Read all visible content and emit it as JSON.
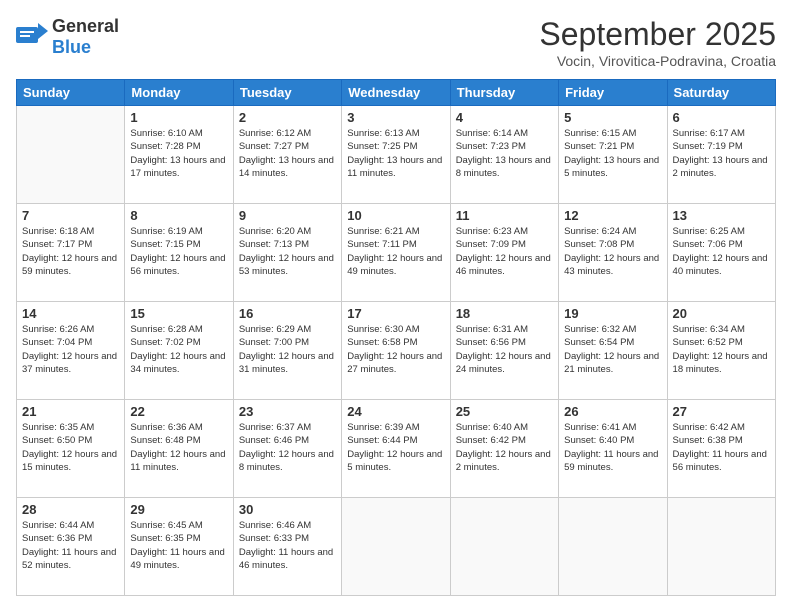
{
  "header": {
    "logo_general": "General",
    "logo_blue": "Blue",
    "title": "September 2025",
    "location": "Vocin, Virovitica-Podravina, Croatia"
  },
  "days_of_week": [
    "Sunday",
    "Monday",
    "Tuesday",
    "Wednesday",
    "Thursday",
    "Friday",
    "Saturday"
  ],
  "weeks": [
    [
      {
        "day": "",
        "sunrise": "",
        "sunset": "",
        "daylight": ""
      },
      {
        "day": "1",
        "sunrise": "Sunrise: 6:10 AM",
        "sunset": "Sunset: 7:28 PM",
        "daylight": "Daylight: 13 hours and 17 minutes."
      },
      {
        "day": "2",
        "sunrise": "Sunrise: 6:12 AM",
        "sunset": "Sunset: 7:27 PM",
        "daylight": "Daylight: 13 hours and 14 minutes."
      },
      {
        "day": "3",
        "sunrise": "Sunrise: 6:13 AM",
        "sunset": "Sunset: 7:25 PM",
        "daylight": "Daylight: 13 hours and 11 minutes."
      },
      {
        "day": "4",
        "sunrise": "Sunrise: 6:14 AM",
        "sunset": "Sunset: 7:23 PM",
        "daylight": "Daylight: 13 hours and 8 minutes."
      },
      {
        "day": "5",
        "sunrise": "Sunrise: 6:15 AM",
        "sunset": "Sunset: 7:21 PM",
        "daylight": "Daylight: 13 hours and 5 minutes."
      },
      {
        "day": "6",
        "sunrise": "Sunrise: 6:17 AM",
        "sunset": "Sunset: 7:19 PM",
        "daylight": "Daylight: 13 hours and 2 minutes."
      }
    ],
    [
      {
        "day": "7",
        "sunrise": "Sunrise: 6:18 AM",
        "sunset": "Sunset: 7:17 PM",
        "daylight": "Daylight: 12 hours and 59 minutes."
      },
      {
        "day": "8",
        "sunrise": "Sunrise: 6:19 AM",
        "sunset": "Sunset: 7:15 PM",
        "daylight": "Daylight: 12 hours and 56 minutes."
      },
      {
        "day": "9",
        "sunrise": "Sunrise: 6:20 AM",
        "sunset": "Sunset: 7:13 PM",
        "daylight": "Daylight: 12 hours and 53 minutes."
      },
      {
        "day": "10",
        "sunrise": "Sunrise: 6:21 AM",
        "sunset": "Sunset: 7:11 PM",
        "daylight": "Daylight: 12 hours and 49 minutes."
      },
      {
        "day": "11",
        "sunrise": "Sunrise: 6:23 AM",
        "sunset": "Sunset: 7:09 PM",
        "daylight": "Daylight: 12 hours and 46 minutes."
      },
      {
        "day": "12",
        "sunrise": "Sunrise: 6:24 AM",
        "sunset": "Sunset: 7:08 PM",
        "daylight": "Daylight: 12 hours and 43 minutes."
      },
      {
        "day": "13",
        "sunrise": "Sunrise: 6:25 AM",
        "sunset": "Sunset: 7:06 PM",
        "daylight": "Daylight: 12 hours and 40 minutes."
      }
    ],
    [
      {
        "day": "14",
        "sunrise": "Sunrise: 6:26 AM",
        "sunset": "Sunset: 7:04 PM",
        "daylight": "Daylight: 12 hours and 37 minutes."
      },
      {
        "day": "15",
        "sunrise": "Sunrise: 6:28 AM",
        "sunset": "Sunset: 7:02 PM",
        "daylight": "Daylight: 12 hours and 34 minutes."
      },
      {
        "day": "16",
        "sunrise": "Sunrise: 6:29 AM",
        "sunset": "Sunset: 7:00 PM",
        "daylight": "Daylight: 12 hours and 31 minutes."
      },
      {
        "day": "17",
        "sunrise": "Sunrise: 6:30 AM",
        "sunset": "Sunset: 6:58 PM",
        "daylight": "Daylight: 12 hours and 27 minutes."
      },
      {
        "day": "18",
        "sunrise": "Sunrise: 6:31 AM",
        "sunset": "Sunset: 6:56 PM",
        "daylight": "Daylight: 12 hours and 24 minutes."
      },
      {
        "day": "19",
        "sunrise": "Sunrise: 6:32 AM",
        "sunset": "Sunset: 6:54 PM",
        "daylight": "Daylight: 12 hours and 21 minutes."
      },
      {
        "day": "20",
        "sunrise": "Sunrise: 6:34 AM",
        "sunset": "Sunset: 6:52 PM",
        "daylight": "Daylight: 12 hours and 18 minutes."
      }
    ],
    [
      {
        "day": "21",
        "sunrise": "Sunrise: 6:35 AM",
        "sunset": "Sunset: 6:50 PM",
        "daylight": "Daylight: 12 hours and 15 minutes."
      },
      {
        "day": "22",
        "sunrise": "Sunrise: 6:36 AM",
        "sunset": "Sunset: 6:48 PM",
        "daylight": "Daylight: 12 hours and 11 minutes."
      },
      {
        "day": "23",
        "sunrise": "Sunrise: 6:37 AM",
        "sunset": "Sunset: 6:46 PM",
        "daylight": "Daylight: 12 hours and 8 minutes."
      },
      {
        "day": "24",
        "sunrise": "Sunrise: 6:39 AM",
        "sunset": "Sunset: 6:44 PM",
        "daylight": "Daylight: 12 hours and 5 minutes."
      },
      {
        "day": "25",
        "sunrise": "Sunrise: 6:40 AM",
        "sunset": "Sunset: 6:42 PM",
        "daylight": "Daylight: 12 hours and 2 minutes."
      },
      {
        "day": "26",
        "sunrise": "Sunrise: 6:41 AM",
        "sunset": "Sunset: 6:40 PM",
        "daylight": "Daylight: 11 hours and 59 minutes."
      },
      {
        "day": "27",
        "sunrise": "Sunrise: 6:42 AM",
        "sunset": "Sunset: 6:38 PM",
        "daylight": "Daylight: 11 hours and 56 minutes."
      }
    ],
    [
      {
        "day": "28",
        "sunrise": "Sunrise: 6:44 AM",
        "sunset": "Sunset: 6:36 PM",
        "daylight": "Daylight: 11 hours and 52 minutes."
      },
      {
        "day": "29",
        "sunrise": "Sunrise: 6:45 AM",
        "sunset": "Sunset: 6:35 PM",
        "daylight": "Daylight: 11 hours and 49 minutes."
      },
      {
        "day": "30",
        "sunrise": "Sunrise: 6:46 AM",
        "sunset": "Sunset: 6:33 PM",
        "daylight": "Daylight: 11 hours and 46 minutes."
      },
      {
        "day": "",
        "sunrise": "",
        "sunset": "",
        "daylight": ""
      },
      {
        "day": "",
        "sunrise": "",
        "sunset": "",
        "daylight": ""
      },
      {
        "day": "",
        "sunrise": "",
        "sunset": "",
        "daylight": ""
      },
      {
        "day": "",
        "sunrise": "",
        "sunset": "",
        "daylight": ""
      }
    ]
  ]
}
